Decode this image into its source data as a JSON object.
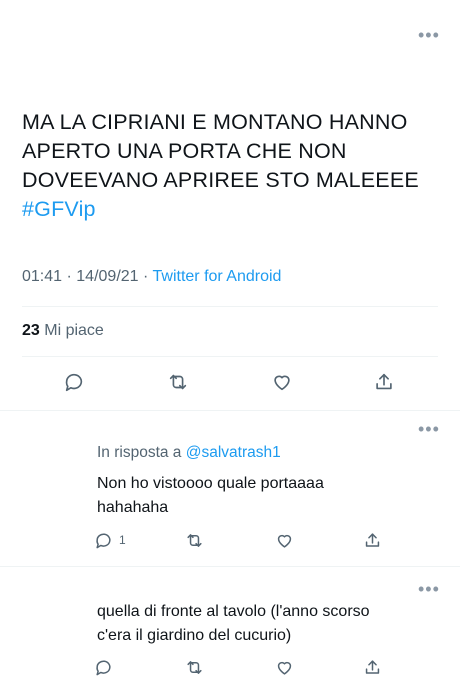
{
  "main_tweet": {
    "text": "MA LA CIPRIANI E MONTANO HANNO APERTO UNA PORTA CHE NON DOVEEVANO APRIREE STO MALEEEE",
    "hashtag": "#GFVip",
    "time": "01:41",
    "separator": "·",
    "date": "14/09/21",
    "source": "Twitter for Android",
    "likes_count": "23",
    "likes_label": "Mi piace"
  },
  "replies": [
    {
      "reply_prefix": "In risposta a",
      "reply_handle": "@salvatrash1",
      "text_line1": "Non ho vistoooo quale portaaaa",
      "text_line2": "hahahaha",
      "reply_count": "1"
    },
    {
      "text_line1": "quella di fronte al tavolo (l'anno scorso",
      "text_line2": "c'era il giardino del cucurio)"
    }
  ],
  "icons": {
    "more": "more-horizontal-icon",
    "reply": "reply-bubble-icon",
    "retweet": "retweet-icon",
    "like": "heart-icon",
    "share": "share-icon"
  },
  "colors": {
    "accent": "#1d9bf0",
    "icon_gray": "#536471",
    "text": "#0f1419"
  }
}
